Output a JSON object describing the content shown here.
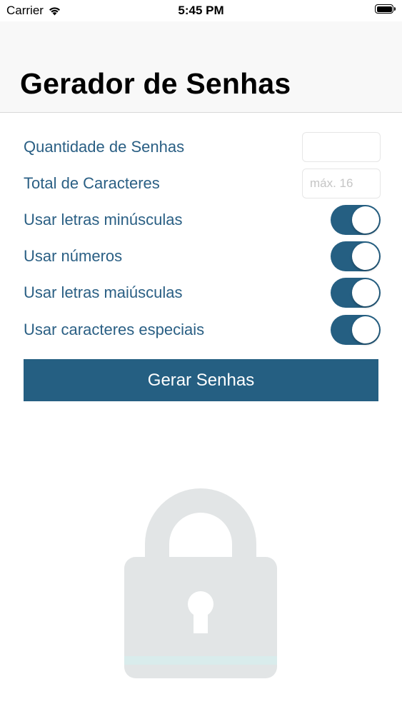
{
  "status_bar": {
    "carrier": "Carrier",
    "time": "5:45 PM"
  },
  "header": {
    "title": "Gerador de Senhas"
  },
  "form": {
    "quantity": {
      "label": "Quantidade de Senhas",
      "value": "",
      "placeholder": ""
    },
    "length": {
      "label": "Total de Caracteres",
      "value": "",
      "placeholder": "máx. 16"
    },
    "toggles": [
      {
        "label": "Usar letras minúsculas",
        "on": true
      },
      {
        "label": "Usar números",
        "on": true
      },
      {
        "label": "Usar letras maiúsculas",
        "on": true
      },
      {
        "label": "Usar caracteres especiais",
        "on": true
      }
    ],
    "generate_label": "Gerar Senhas"
  },
  "colors": {
    "accent": "#255f82",
    "label": "#2a5f84",
    "lock": "#e2e5e6"
  },
  "icons": {
    "wifi": "wifi-icon",
    "battery": "battery-icon",
    "illustration": "lock-icon"
  }
}
